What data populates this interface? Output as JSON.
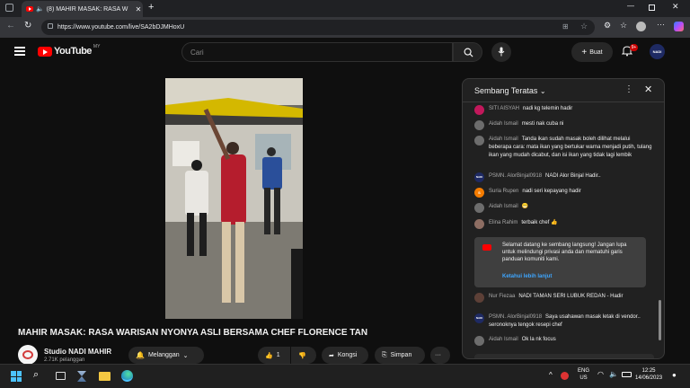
{
  "browser": {
    "tab_title": "(8) MAHIR MASAK: RASA W",
    "url": "https://www.youtube.com/live/SA2bDJMHoxU"
  },
  "youtube": {
    "logo_text": "YouTube",
    "region": "MY",
    "search_placeholder": "Cari",
    "create_label": "Buat",
    "notification_count": "9+",
    "avatar_text": "NADI"
  },
  "video": {
    "title": "MAHIR MASAK: RASA WARISAN NYONYA ASLI BERSAMA CHEF FLORENCE TAN",
    "channel": "Studio NADI MAHIR",
    "subscribers": "2.71K pelanggan",
    "subscribe_label": "Melanggan",
    "like_count": "1",
    "share_label": "Kongsi",
    "save_label": "Simpan"
  },
  "chat": {
    "header": "Sembang Teratas",
    "messages": [
      {
        "author": "SITI AISYAH",
        "text": "nadi kg telemin hadir",
        "avatar_color": "#c2185b"
      },
      {
        "author": "Aidah Ismail",
        "text": "mesti nak cuba ni",
        "avatar_color": "#6d6d6d"
      },
      {
        "author": "Aidah Ismail",
        "text": "Tanda ikan sudah masak boleh dilihat melalui beberapa cara: mata ikan yang bertukar warna menjadi putih, tulang ikan yang mudah dicabut, dan isi ikan yang tidak lagi lembik",
        "avatar_color": "#6d6d6d"
      },
      {
        "author": "PSMN. AlorBinjal0918",
        "text": "NADI Alor Binjal Hadir..",
        "avatar_color": "#1e2a63",
        "avatar_text": "NADI"
      },
      {
        "author": "Suria Rupen",
        "text": "nadi seri kepayang hadir",
        "avatar_color": "#f57c00",
        "avatar_text": "S"
      },
      {
        "author": "Aidah Ismail",
        "text": "😁",
        "avatar_color": "#6d6d6d"
      },
      {
        "author": "Elina Rahim",
        "text": "terbaik chef 👍",
        "avatar_color": "#8e6e63"
      },
      {
        "author": "Nur Fiezaa",
        "text": "NADI TAMAN SERI LUBUK REDAN - Hadir",
        "avatar_color": "#5d4037"
      },
      {
        "author": "PSMN. AlorBinjal0918",
        "text": "Saya usahawan masak letak di vendor.. seronoknya tengok resepi chef",
        "avatar_color": "#1e2a63",
        "avatar_text": "NADI"
      },
      {
        "author": "Aidah Ismail",
        "text": "Ok la nk focus",
        "avatar_color": "#6d6d6d"
      }
    ],
    "welcome_text": "Selamat datang ke sembang langsung! Jangan lupa untuk melindungi privasi anda dan mematuhi garis panduan komuniti kami.",
    "welcome_link": "Ketahui lebih lanjut"
  },
  "taskbar": {
    "lang_top": "ENG",
    "lang_bottom": "US",
    "time": "12:25",
    "date": "14/06/2023"
  }
}
